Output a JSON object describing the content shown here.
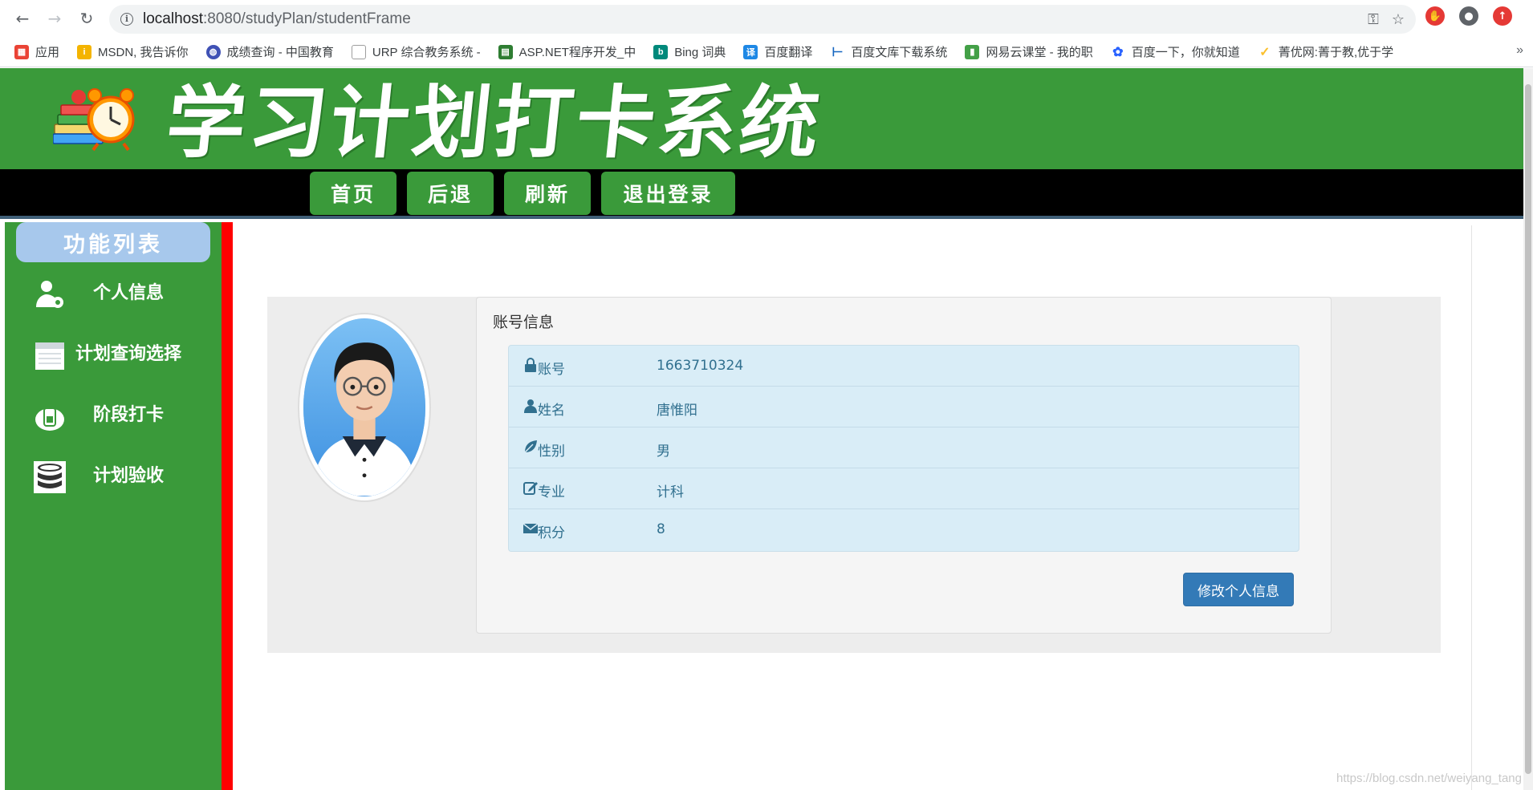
{
  "browser": {
    "url_host": "localhost",
    "url_path": ":8080/studyPlan/studentFrame",
    "bookmarks": [
      {
        "label": "应用",
        "color": "#ea4335"
      },
      {
        "label": "MSDN, 我告诉你",
        "color": "#f4b400"
      },
      {
        "label": "成绩查询 - 中国教育",
        "color": "#3f51b5"
      },
      {
        "label": "URP 综合教务系统 -",
        "color": "#9e9e9e"
      },
      {
        "label": "ASP.NET程序开发_中",
        "color": "#2e7d32"
      },
      {
        "label": "Bing 词典",
        "color": "#00897b"
      },
      {
        "label": "百度翻译",
        "color": "#1e88e5"
      },
      {
        "label": "百度文库下载系统",
        "color": "#1565c0"
      },
      {
        "label": "网易云课堂 - 我的职",
        "color": "#43a047"
      },
      {
        "label": "百度一下，你就知道",
        "color": "#2962ff"
      },
      {
        "label": "菁优网:菁于教,优于学",
        "color": "#fbc02d"
      }
    ]
  },
  "header": {
    "site_title": "学习计划打卡系统"
  },
  "topnav": {
    "home": "首页",
    "back": "后退",
    "refresh": "刷新",
    "logout": "退出登录"
  },
  "sidebar": {
    "title": "功能列表",
    "items": [
      {
        "label": "个人信息",
        "icon": "user-gear-icon"
      },
      {
        "label": "计划查询选择",
        "icon": "calendar-icon"
      },
      {
        "label": "阶段打卡",
        "icon": "check-in-icon"
      },
      {
        "label": "计划验收",
        "icon": "database-icon"
      }
    ]
  },
  "account": {
    "card_title": "账号信息",
    "rows": [
      {
        "label": "账号",
        "value": "1663710324",
        "icon": "lock-icon"
      },
      {
        "label": "姓名",
        "value": "唐惟阳",
        "icon": "user-icon"
      },
      {
        "label": "性别",
        "value": "男",
        "icon": "leaf-icon"
      },
      {
        "label": "专业",
        "value": "计科",
        "icon": "edit-icon"
      },
      {
        "label": "积分",
        "value": "8",
        "icon": "envelope-icon"
      }
    ],
    "edit_button": "修改个人信息"
  },
  "watermark": "https://blog.csdn.net/weiyang_tang"
}
